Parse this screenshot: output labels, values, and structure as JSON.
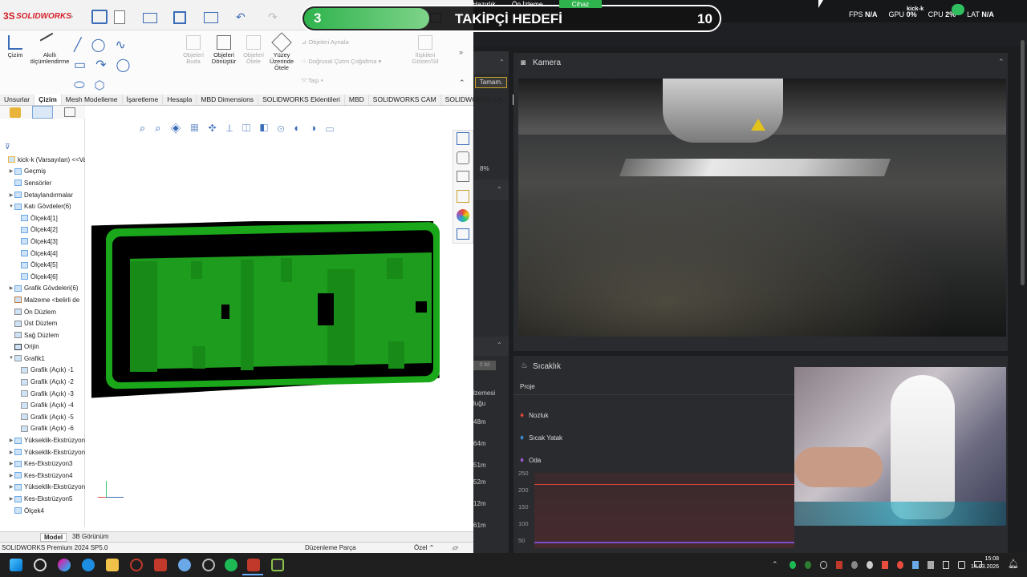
{
  "solidworks": {
    "logo": "SOLIDWORKS",
    "ribbon": {
      "sketch": "Çizim",
      "smart_dim": "Akıllı ölçümlendirme",
      "trim": "Objeleri Buda",
      "convert": "Objeleri Dönüştür",
      "offset": "Objeleri Ötele",
      "surface_offset": "Yüzey Üzerinde Ötele",
      "mirror": "Objeleri Aynala",
      "linear_pattern": "Doğrusal Çizim Çoğaltma",
      "move": "Taşı",
      "relations": "İlişkileri Göster/Sil"
    },
    "tabs": [
      "Unsurlar",
      "Çizim",
      "Mesh Modelleme",
      "İşaretleme",
      "Hesapla",
      "MBD Dimensions",
      "SOLIDWORKS Eklentileri",
      "MBD",
      "SOLIDWORKS CAM",
      "SOLIDWORKS CA..."
    ],
    "active_tab": "Çizim",
    "tree": [
      {
        "label": "kick-k (Varsayılan) <<Va",
        "arrow": "",
        "indent": 0,
        "icon": "part"
      },
      {
        "label": "Geçmiş",
        "arrow": "▶",
        "indent": 1,
        "icon": "folder"
      },
      {
        "label": "Sensörler",
        "arrow": "",
        "indent": 1,
        "icon": "folder"
      },
      {
        "label": "Detaylandırmalar",
        "arrow": "▶",
        "indent": 1,
        "icon": "folder"
      },
      {
        "label": "Katı Gövdeler(6)",
        "arrow": "▼",
        "indent": 1,
        "icon": "folder"
      },
      {
        "label": "Ölçek4[1]",
        "arrow": "",
        "indent": 2,
        "icon": "body"
      },
      {
        "label": "Ölçek4[2]",
        "arrow": "",
        "indent": 2,
        "icon": "body"
      },
      {
        "label": "Ölçek4[3]",
        "arrow": "",
        "indent": 2,
        "icon": "body"
      },
      {
        "label": "Ölçek4[4]",
        "arrow": "",
        "indent": 2,
        "icon": "body"
      },
      {
        "label": "Ölçek4[5]",
        "arrow": "",
        "indent": 2,
        "icon": "body"
      },
      {
        "label": "Ölçek4[6]",
        "arrow": "",
        "indent": 2,
        "icon": "body"
      },
      {
        "label": "Grafik Gövdeleri(6)",
        "arrow": "▶",
        "indent": 1,
        "icon": "folder"
      },
      {
        "label": "Malzeme <belirli de",
        "arrow": "",
        "indent": 1,
        "icon": "material"
      },
      {
        "label": "Ön Düzlem",
        "arrow": "",
        "indent": 1,
        "icon": "plane"
      },
      {
        "label": "Üst Düzlem",
        "arrow": "",
        "indent": 1,
        "icon": "plane"
      },
      {
        "label": "Sağ Düzlem",
        "arrow": "",
        "indent": 1,
        "icon": "plane"
      },
      {
        "label": "Orijin",
        "arrow": "",
        "indent": 1,
        "icon": "origin"
      },
      {
        "label": "Grafik1",
        "arrow": "▼",
        "indent": 1,
        "icon": "graphic"
      },
      {
        "label": "Grafik (Açık) -1",
        "arrow": "",
        "indent": 2,
        "icon": "graphic"
      },
      {
        "label": "Grafik (Açık) -2",
        "arrow": "",
        "indent": 2,
        "icon": "graphic"
      },
      {
        "label": "Grafik (Açık) -3",
        "arrow": "",
        "indent": 2,
        "icon": "graphic"
      },
      {
        "label": "Grafik (Açık) -4",
        "arrow": "",
        "indent": 2,
        "icon": "graphic"
      },
      {
        "label": "Grafik (Açık) -5",
        "arrow": "",
        "indent": 2,
        "icon": "graphic"
      },
      {
        "label": "Grafik (Açık) -6",
        "arrow": "",
        "indent": 2,
        "icon": "graphic"
      },
      {
        "label": "Yükseklik-Ekstrüzyon",
        "arrow": "▶",
        "indent": 1,
        "icon": "feature"
      },
      {
        "label": "Yükseklik-Ekstrüzyon",
        "arrow": "▶",
        "indent": 1,
        "icon": "feature"
      },
      {
        "label": "Kes-Ekstrüzyon3",
        "arrow": "▶",
        "indent": 1,
        "icon": "feature"
      },
      {
        "label": "Kes-Ekstrüzyon4",
        "arrow": "▶",
        "indent": 1,
        "icon": "feature"
      },
      {
        "label": "Yükseklik-Ekstrüzyon",
        "arrow": "▶",
        "indent": 1,
        "icon": "feature"
      },
      {
        "label": "Kes-Ekstrüzyon5",
        "arrow": "▶",
        "indent": 1,
        "icon": "feature"
      },
      {
        "label": "Ölçek4",
        "arrow": "",
        "indent": 1,
        "icon": "feature"
      }
    ],
    "bottom_tabs": [
      "Model",
      "3B Görünüm"
    ],
    "status_left": "SOLIDWORKS Premium 2024 SP5.0",
    "status_mid": "Düzenleme Parça",
    "status_right": "Özel"
  },
  "overlay": {
    "left_count": "3",
    "title": "TAKİPÇİ HEDEFİ",
    "right_count": "10"
  },
  "dark_app": {
    "top_tabs": [
      "Hazırlık",
      "Ön İzleme",
      "Cihaz"
    ],
    "stats": [
      {
        "label": "FPS",
        "value": "N/A"
      },
      {
        "label": "GPU",
        "value": "0%"
      },
      {
        "label": "CPU",
        "value": "2%"
      },
      {
        "label": "LAT",
        "value": "N/A"
      }
    ],
    "user": "kick-k",
    "ok_button": "Tamam.",
    "percent": "8%",
    "side_labels": [
      "lzemesi",
      "luğu",
      "48m",
      "64m",
      "51m",
      "52m",
      "12m",
      "61m"
    ],
    "camera_title": "Kamera",
    "temp_title": "Sıcaklık",
    "temp_tab": "Proje",
    "temp_items": [
      {
        "label": "Nozluk",
        "color": "#e0453a"
      },
      {
        "label": "Sıcak Yatak",
        "color": "#3a8ee0"
      },
      {
        "label": "Oda",
        "color": "#9b59d0"
      }
    ],
    "chart_y_ticks": [
      "250",
      "200",
      "150",
      "100",
      "50"
    ],
    "grey_chip": "0 bil"
  },
  "taskbar": {
    "time": "15:08",
    "date": "14.03.2026"
  }
}
